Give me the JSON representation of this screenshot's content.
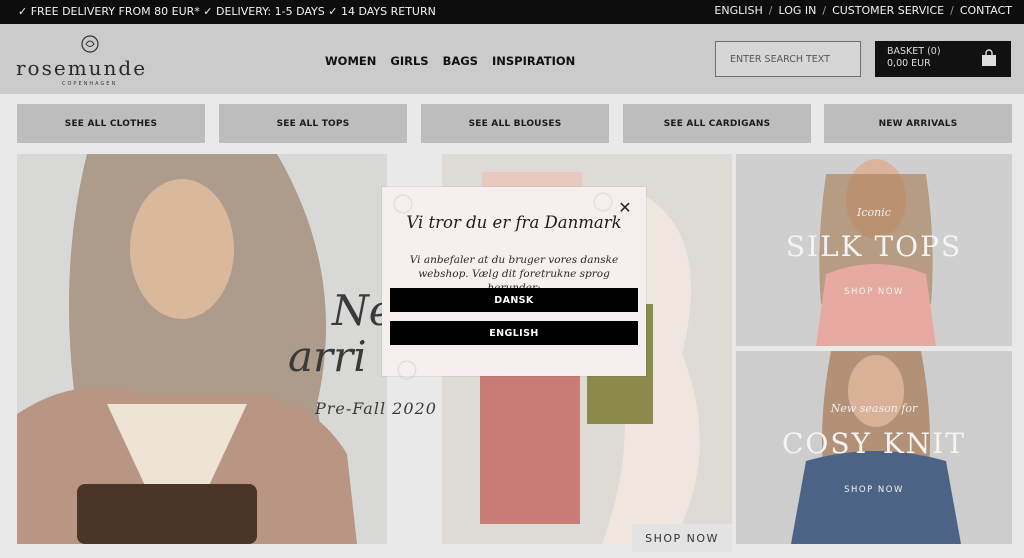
{
  "topbar": {
    "promo": "✓ FREE DELIVERY FROM 80 EUR* ✓ DELIVERY: 1-5 DAYS ✓ 14 DAYS RETURN",
    "links": [
      "ENGLISH",
      "LOG IN",
      "CUSTOMER SERVICE",
      "CONTACT"
    ]
  },
  "header": {
    "logo_word": "rosemunde",
    "logo_sub": "COPENHAGEN",
    "nav": [
      "WOMEN",
      "GIRLS",
      "BAGS",
      "INSPIRATION"
    ],
    "search_placeholder": "ENTER SEARCH TEXT",
    "basket_label": "BASKET (0)",
    "basket_total": "0,00 EUR"
  },
  "categories": [
    "SEE ALL CLOTHES",
    "SEE ALL TOPS",
    "SEE ALL BLOUSES",
    "SEE ALL CARDIGANS",
    "NEW ARRIVALS"
  ],
  "banners": {
    "left": {
      "line1": "Ne",
      "line2": "arri",
      "season": "Pre-Fall 2020"
    },
    "middle": {
      "cta": "SHOP NOW"
    },
    "right_top": {
      "small": "Iconic",
      "big": "SILK TOPS",
      "cta": "SHOP NOW"
    },
    "right_bottom": {
      "small": "New season for",
      "big": "COSY KNIT",
      "cta": "SHOP NOW"
    }
  },
  "modal": {
    "title": "Vi tror du er fra Danmark",
    "message": "Vi anbefaler at du bruger vores danske webshop. Vælg dit foretrukne sprog herunder:",
    "buttons": [
      "DANSK",
      "ENGLISH"
    ],
    "close": "✕"
  }
}
